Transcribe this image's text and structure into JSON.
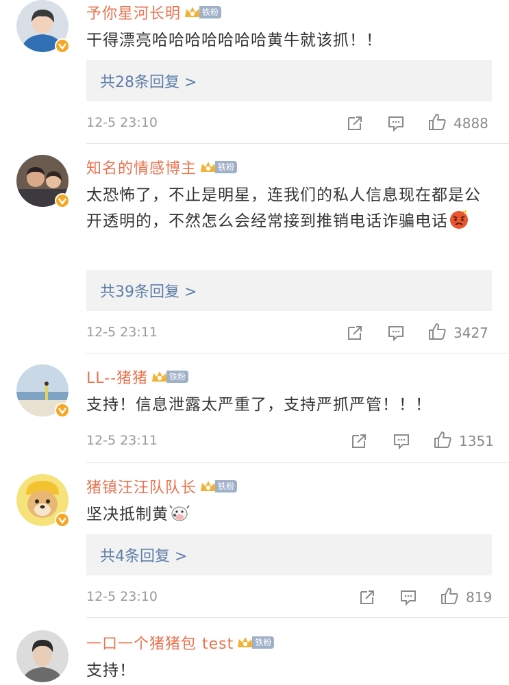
{
  "fan_badge_label": "铁粉",
  "colors": {
    "username": "#eb7350",
    "reply_link": "#5d7ea8",
    "meta": "#9a9a9a",
    "reply_bg": "#f2f2f2"
  },
  "comments": [
    {
      "username": "予你星河长明",
      "text": "干得漂亮哈哈哈哈哈哈哈黄牛就该抓！！",
      "reply_label": "共28条回复 >",
      "time": "12-5 23:10",
      "likes": "4888",
      "avatar_icon": "avatar-boy-blue-jacket"
    },
    {
      "username": "知名的情感博主",
      "text": "太恐怖了，不止是明星，连我们的私人信息现在都是公开透明的，不然怎么会经常接到推销电话诈骗电话",
      "emoji": "angry-face-emoji",
      "reply_label": "共39条回复 >",
      "time": "12-5 23:11",
      "likes": "3427",
      "avatar_icon": "avatar-two-people"
    },
    {
      "username": "LL--猪猪",
      "text": "支持！信息泄露太严重了，支持严抓严管！！！",
      "time": "12-5 23:11",
      "likes": "1351",
      "avatar_icon": "avatar-beach"
    },
    {
      "username": "猪镇汪汪队队长",
      "text": "坚决抵制黄",
      "emoji": "cow-emoji",
      "reply_label": "共4条回复 >",
      "time": "12-5 23:10",
      "likes": "819",
      "avatar_icon": "avatar-cartoon-dog"
    },
    {
      "username": "一口一个猪猪包 test",
      "text": "支持！",
      "avatar_icon": "avatar-young-man"
    }
  ]
}
